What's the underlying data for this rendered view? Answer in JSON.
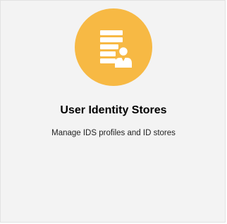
{
  "card": {
    "title": "User Identity Stores",
    "description": "Manage IDS profiles and ID stores",
    "icon": "user-identity-store-icon",
    "accent_color": "#f7b944",
    "background_color": "#f3f3f3"
  }
}
